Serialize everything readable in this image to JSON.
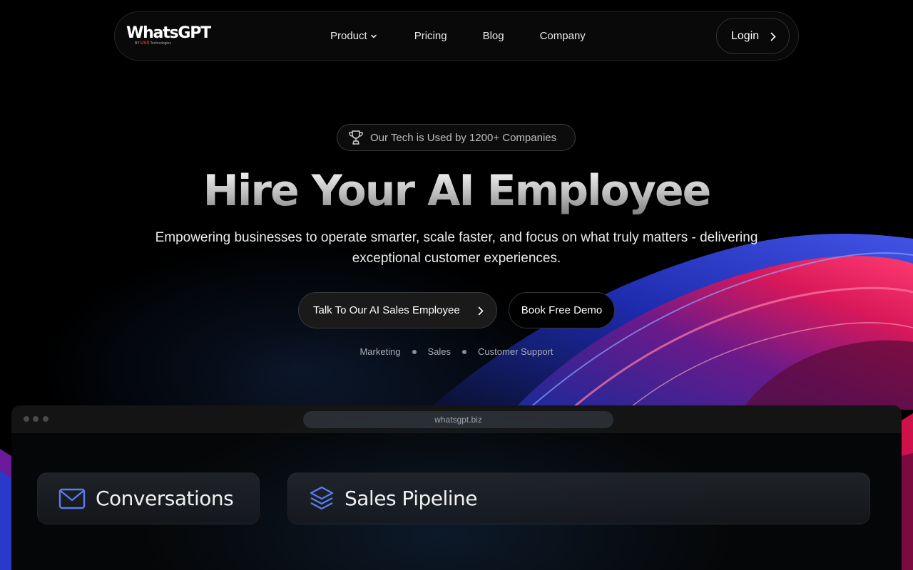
{
  "brand": {
    "name": "WhatsGPT",
    "by": "BY",
    "company_mark": "UVX",
    "company_rest": "Technologies"
  },
  "nav": {
    "items": [
      {
        "label": "Product",
        "has_dropdown": true,
        "icon": "chevron-down-icon"
      },
      {
        "label": "Pricing"
      },
      {
        "label": "Blog"
      },
      {
        "label": "Company"
      }
    ],
    "login_label": "Login"
  },
  "hero": {
    "badge_text": "Our Tech is Used by 1200+ Companies",
    "badge_icon": "trophy-icon",
    "title": "Hire Your AI Employee",
    "subtitle": "Empowering businesses to operate smarter, scale faster, and focus on what truly matters - delivering exceptional customer experiences.",
    "cta_primary": "Talk To Our AI Sales Employee",
    "cta_secondary": "Book Free Demo",
    "tags": [
      "Marketing",
      "Sales",
      "Customer Support"
    ]
  },
  "browser": {
    "url": "whatsgpt.biz",
    "cards": [
      {
        "title": "Conversations",
        "icon": "mail-icon"
      },
      {
        "title": "Sales Pipeline",
        "icon": "layers-icon"
      }
    ]
  },
  "colors": {
    "accent": "#5a7cf0",
    "swirl_pink": "#e0145a",
    "swirl_blue": "#2a45d8",
    "background": "#000000"
  }
}
